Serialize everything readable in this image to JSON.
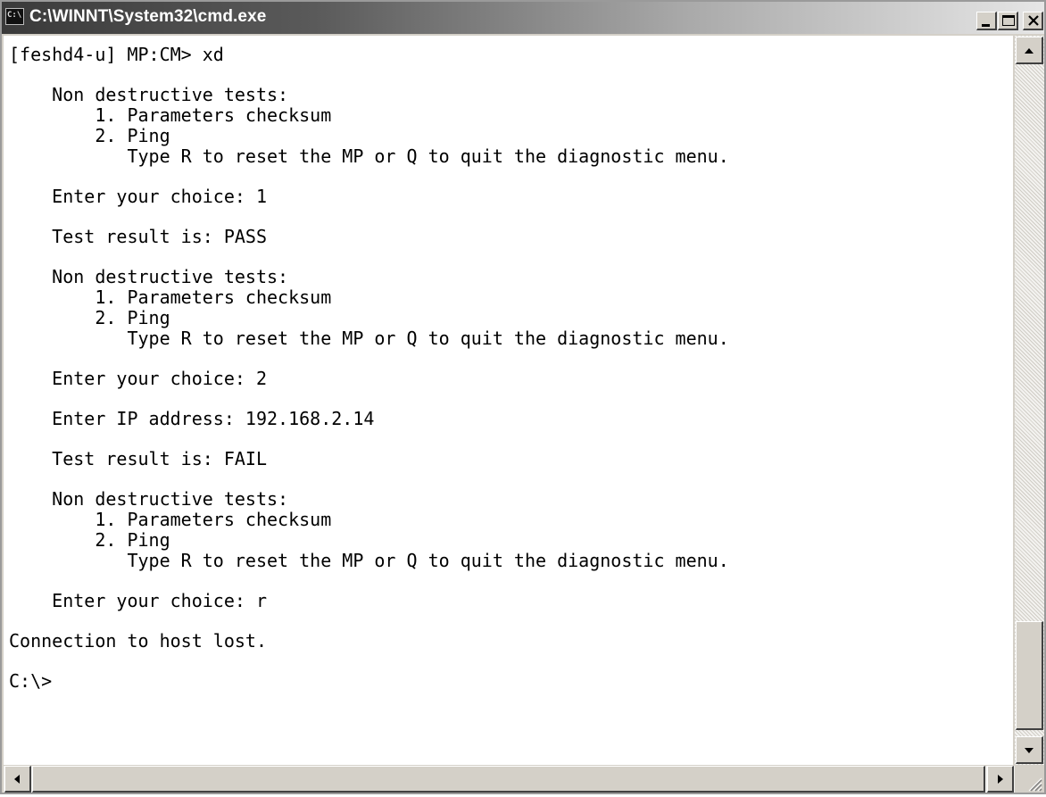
{
  "window": {
    "title": "C:\\WINNT\\System32\\cmd.exe",
    "icon_label": "C:\\"
  },
  "console": {
    "lines": [
      "[feshd4-u] MP:CM> xd",
      "",
      "    Non destructive tests:",
      "        1. Parameters checksum",
      "        2. Ping",
      "           Type R to reset the MP or Q to quit the diagnostic menu.",
      "",
      "    Enter your choice: 1",
      "",
      "    Test result is: PASS",
      "",
      "    Non destructive tests:",
      "        1. Parameters checksum",
      "        2. Ping",
      "           Type R to reset the MP or Q to quit the diagnostic menu.",
      "",
      "    Enter your choice: 2",
      "",
      "    Enter IP address: 192.168.2.14",
      "",
      "    Test result is: FAIL",
      "",
      "    Non destructive tests:",
      "        1. Parameters checksum",
      "        2. Ping",
      "           Type R to reset the MP or Q to quit the diagnostic menu.",
      "",
      "    Enter your choice: r",
      "",
      "Connection to host lost.",
      "",
      "C:\\>"
    ]
  },
  "icons": {
    "window": "cmd-window-icon",
    "minimize": "minimize-icon",
    "maximize": "maximize-icon",
    "close": "close-icon",
    "scroll_up": "arrow-up-icon",
    "scroll_down": "arrow-down-icon",
    "scroll_left": "arrow-left-icon",
    "scroll_right": "arrow-right-icon"
  },
  "scroll": {
    "vertical_position": 0.92
  },
  "colors": {
    "console_background": "#ffffff",
    "console_text": "#000000",
    "titlebar_start": "#3a3a3a",
    "titlebar_end": "#e6e6e6"
  }
}
